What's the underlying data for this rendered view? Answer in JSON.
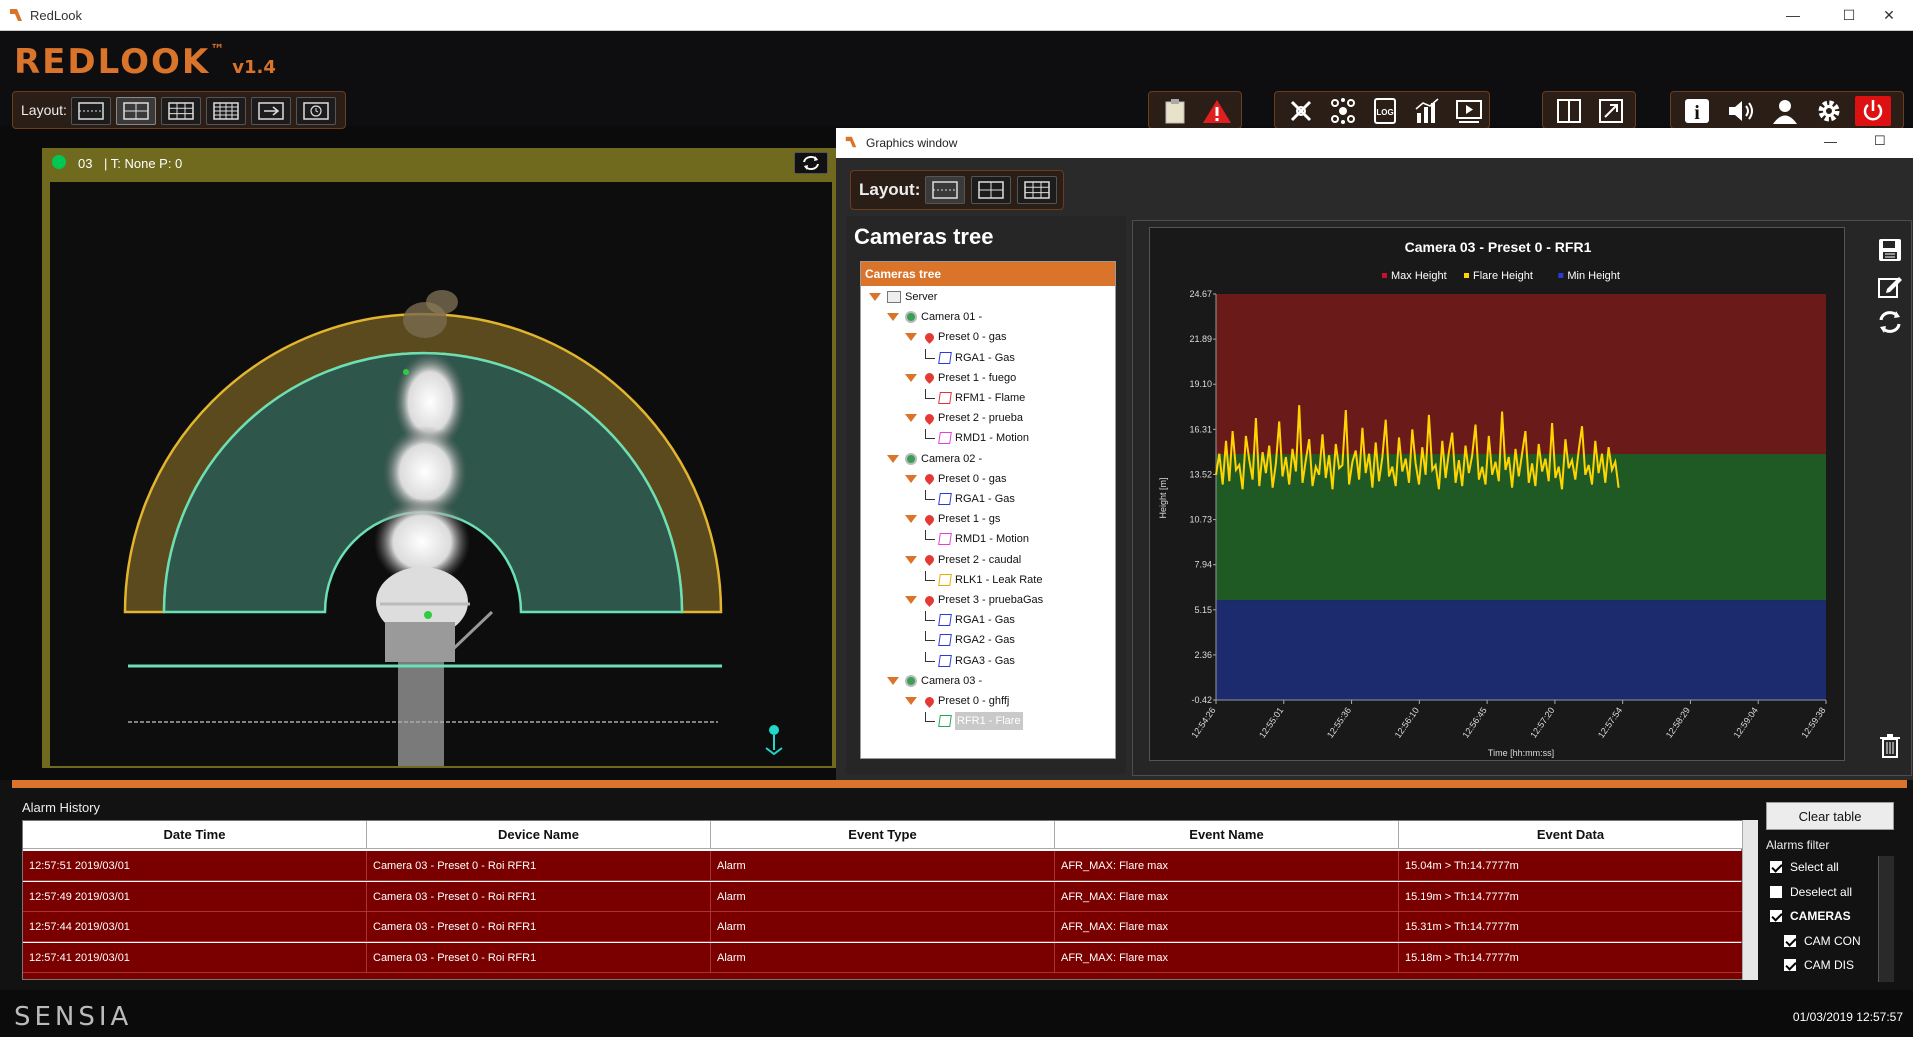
{
  "window": {
    "title": "RedLook",
    "min": "—",
    "max": "☐",
    "close": "✕"
  },
  "app": {
    "logo_text": "REDLOOK",
    "logo_tm": "™",
    "version": "v1.4"
  },
  "layout_bar": {
    "label": "Layout:"
  },
  "toolbar": {
    "groups": [
      {
        "icons": [
          "clipboard-icon",
          "alarm-warning-icon"
        ]
      },
      {
        "icons": [
          "tools-icon",
          "network-icon",
          "log-icon",
          "stats-icon",
          "player-icon"
        ]
      },
      {
        "icons": [
          "split-view-icon",
          "resize-icon"
        ]
      },
      {
        "icons": [
          "info-icon",
          "sound-icon",
          "user-icon",
          "settings-icon",
          "power-icon"
        ]
      }
    ],
    "log_label": "LOG",
    "info_label": "i"
  },
  "video": {
    "cam_id": "03",
    "status": "| T: None  P: 0",
    "status_color": "#00c853"
  },
  "graphics_window": {
    "title": "Graphics window",
    "layout_label": "Layout:",
    "tree_header": "Cameras tree",
    "tree_title_bar": "Cameras tree",
    "tree": [
      {
        "label": "Server",
        "level": 0,
        "icon": "server"
      },
      {
        "label": "Camera 01 -",
        "level": 1,
        "icon": "camera"
      },
      {
        "label": "Preset 0 - gas",
        "level": 2,
        "icon": "pin"
      },
      {
        "label": "RGA1 - Gas",
        "level": 3,
        "icon": "roi-blue"
      },
      {
        "label": "Preset 1 - fuego",
        "level": 2,
        "icon": "pin"
      },
      {
        "label": "RFM1 - Flame",
        "level": 3,
        "icon": "roi-red"
      },
      {
        "label": "Preset 2 - prueba",
        "level": 2,
        "icon": "pin"
      },
      {
        "label": "RMD1 - Motion",
        "level": 3,
        "icon": "roi-magenta"
      },
      {
        "label": "Camera 02 -",
        "level": 1,
        "icon": "camera"
      },
      {
        "label": "Preset 0 - gas",
        "level": 2,
        "icon": "pin"
      },
      {
        "label": "RGA1 - Gas",
        "level": 3,
        "icon": "roi-blue"
      },
      {
        "label": "Preset 1 - gs",
        "level": 2,
        "icon": "pin"
      },
      {
        "label": "RMD1 - Motion",
        "level": 3,
        "icon": "roi-magenta"
      },
      {
        "label": "Preset 2 - caudal",
        "level": 2,
        "icon": "pin"
      },
      {
        "label": "RLK1 - Leak Rate",
        "level": 3,
        "icon": "roi-yellow"
      },
      {
        "label": "Preset 3 - pruebaGas",
        "level": 2,
        "icon": "pin"
      },
      {
        "label": "RGA1 - Gas",
        "level": 3,
        "icon": "roi-blue"
      },
      {
        "label": "RGA2 - Gas",
        "level": 3,
        "icon": "roi-blue"
      },
      {
        "label": "RGA3 - Gas",
        "level": 3,
        "icon": "roi-blue"
      },
      {
        "label": "Camera 03 -",
        "level": 1,
        "icon": "camera"
      },
      {
        "label": "Preset 0 - ghffj",
        "level": 2,
        "icon": "pin"
      },
      {
        "label": "RFR1 - Flare",
        "level": 3,
        "icon": "roi-green",
        "selected": true
      }
    ]
  },
  "chart_data": {
    "type": "line",
    "title": "Camera 03 - Preset 0 - RFR1",
    "xlabel": "Time [hh:mm:ss]",
    "ylabel": "Height [m]",
    "ylim": [
      -0.42,
      24.67
    ],
    "yticks": [
      "24.67",
      "21.89",
      "19.10",
      "16.31",
      "13.52",
      "10.73",
      "7.94",
      "5.15",
      "2.36",
      "-0.42"
    ],
    "xticks": [
      "12:54:26",
      "12:55:01",
      "12:55:36",
      "12:56:10",
      "12:56:45",
      "12:57:20",
      "12:57:54",
      "12:58:29",
      "12:59:04",
      "12:59:38"
    ],
    "legend": [
      {
        "name": "Max Height",
        "color": "#c8102e"
      },
      {
        "name": "Flare Height",
        "color": "#ffd400"
      },
      {
        "name": "Min Height",
        "color": "#2b3bd6"
      }
    ],
    "bands": [
      {
        "name": "Max Height",
        "from": 14.78,
        "to": 24.67,
        "color": "#6b1a1a"
      },
      {
        "name": "Flare Height",
        "from": 5.75,
        "to": 14.78,
        "color": "#1f5a24"
      },
      {
        "name": "Min Height",
        "from": -0.42,
        "to": 5.75,
        "color": "#1c2a6e"
      }
    ],
    "series": [
      {
        "name": "Flare Height",
        "color": "#ffd400",
        "values": [
          13.5,
          14.8,
          12.9,
          15.6,
          13.1,
          16.2,
          13.8,
          14.1,
          12.6,
          15.9,
          14.4,
          13.2,
          17.0,
          12.8,
          14.9,
          13.6,
          15.3,
          12.7,
          14.2,
          16.8,
          13.4,
          14.6,
          12.9,
          15.1,
          13.7,
          17.8,
          13.0,
          14.4,
          15.7,
          12.8,
          14.0,
          13.5,
          16.0,
          13.3,
          14.7,
          12.6,
          15.4,
          13.9,
          14.1,
          17.5,
          12.9,
          14.3,
          15.0,
          13.2,
          16.4,
          13.6,
          14.8,
          12.7,
          15.5,
          13.1,
          14.6,
          16.9,
          13.4,
          14.0,
          12.8,
          15.8,
          13.7,
          14.5,
          13.0,
          16.3,
          14.2,
          12.9,
          15.2,
          13.5,
          17.2,
          13.8,
          14.1,
          12.6,
          15.6,
          13.3,
          14.9,
          16.1,
          13.0,
          14.4,
          12.8,
          15.3,
          13.6,
          14.7,
          16.6,
          13.2,
          14.0,
          12.9,
          15.9,
          13.5,
          14.3,
          13.1,
          17.4,
          13.8,
          14.6,
          12.7,
          15.1,
          13.4,
          14.8,
          16.2,
          13.0,
          14.2,
          12.8,
          15.4,
          13.7,
          14.5,
          13.1,
          16.7,
          13.3,
          14.0,
          12.6,
          15.7,
          13.9,
          14.4,
          13.2,
          15.0,
          16.5,
          13.5,
          14.1,
          12.9,
          15.6,
          13.6,
          14.8,
          13.0,
          15.2,
          13.8,
          14.3,
          12.7
        ]
      }
    ],
    "x_end_fraction": 0.66
  },
  "chart_side_icons": [
    "save-icon",
    "edit-icon",
    "refresh-icon",
    "trash-icon"
  ],
  "alarm_history": {
    "title": "Alarm History",
    "columns": [
      "Date Time",
      "Device Name",
      "Event Type",
      "Event Name",
      "Event Data"
    ],
    "rows": [
      [
        "12:57:51 2019/03/01",
        "Camera 03 - Preset 0 - Roi RFR1",
        "Alarm",
        "AFR_MAX: Flare max",
        "15.04m > Th:14.7777m"
      ],
      [
        "12:57:49 2019/03/01",
        "Camera 03 - Preset 0 - Roi RFR1",
        "Alarm",
        "AFR_MAX: Flare max",
        "15.19m > Th:14.7777m"
      ],
      [
        "12:57:44 2019/03/01",
        "Camera 03 - Preset 0 - Roi RFR1",
        "Alarm",
        "AFR_MAX: Flare max",
        "15.31m > Th:14.7777m"
      ],
      [
        "12:57:41 2019/03/01",
        "Camera 03 - Preset 0 - Roi RFR1",
        "Alarm",
        "AFR_MAX: Flare max",
        "15.18m > Th:14.7777m"
      ]
    ],
    "clear_button": "Clear table",
    "filter_label": "Alarms filter",
    "filters": [
      {
        "label": "Select all",
        "checked": true
      },
      {
        "label": "Deselect all",
        "checked": false
      },
      {
        "label": "CAMERAS",
        "checked": true
      },
      {
        "label": "CAM  CON",
        "checked": true
      },
      {
        "label": "CAM  DIS",
        "checked": true
      }
    ]
  },
  "footer": {
    "brand": "SENSIA",
    "clock": "01/03/2019  12:57:57"
  }
}
